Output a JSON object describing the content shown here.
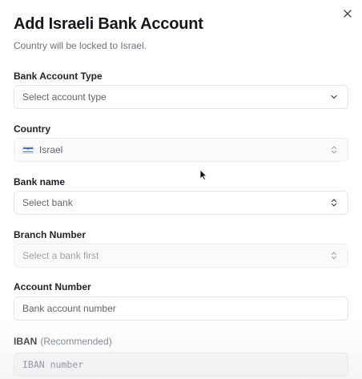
{
  "dialog": {
    "title": "Add Israeli Bank Account",
    "subtitle": "Country will be locked to Israel.",
    "close_icon": "close-icon"
  },
  "fields": {
    "account_type": {
      "label": "Bank Account Type",
      "placeholder": "Select account type",
      "icon": "chevron-down-icon"
    },
    "country": {
      "label": "Country",
      "value": "Israel",
      "flag_icon": "israel-flag-icon",
      "icon": "chevron-up-down-icon"
    },
    "bank_name": {
      "label": "Bank name",
      "placeholder": "Select bank",
      "icon": "chevron-up-down-icon"
    },
    "branch_number": {
      "label": "Branch Number",
      "placeholder": "Select a bank first",
      "icon": "chevron-up-down-icon"
    },
    "account_number": {
      "label": "Account Number",
      "placeholder": "Bank account number"
    },
    "iban": {
      "label": "IBAN",
      "hint": "(Recommended)",
      "placeholder": "IBAN number"
    }
  },
  "colors": {
    "border": "#e3e5e8",
    "title": "#16181d",
    "muted": "#6b7280",
    "flag_blue": "#3b6bd6"
  }
}
